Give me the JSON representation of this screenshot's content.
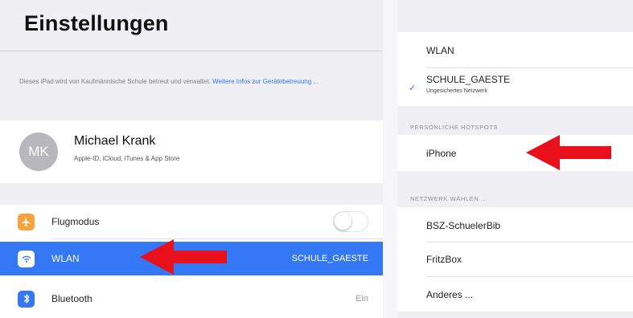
{
  "settings": {
    "title": "Einstellungen",
    "management_text": "Dieses iPad wird von Kaufmännische Schule betreut und verwaltet.",
    "management_link": "Weitere Infos zur Gerätebetreuung ...",
    "profile": {
      "initials": "MK",
      "name": "Michael Krank",
      "subtitle": "Apple-ID, iCloud, iTunes & App Store"
    },
    "items": [
      {
        "label": "Flugmodus",
        "icon": "airplane-icon",
        "color": "#f7a23b",
        "toggle_on": false
      },
      {
        "label": "WLAN",
        "icon": "wifi-icon",
        "color": "#3478f6",
        "value": "SCHULE_GAESTE",
        "selected": true
      },
      {
        "label": "Bluetooth",
        "icon": "bluetooth-icon",
        "color": "#3478f6",
        "value": "Ein"
      }
    ]
  },
  "wlan": {
    "header": "WLAN",
    "connected": {
      "name": "SCHULE_GAESTE",
      "status": "Ungesichertes Netzwerk"
    },
    "hotspots_section": "PERSÖNLICHE HOTSPOTS",
    "hotspots": [
      "iPhone"
    ],
    "networks_section": "NETZWERK WÄHLEN ...",
    "networks": [
      "BSZ-SchuelerBib",
      "FritzBox",
      "Anderes ..."
    ]
  },
  "accent_color": "#3478f6",
  "arrow_color": "#e8101a"
}
